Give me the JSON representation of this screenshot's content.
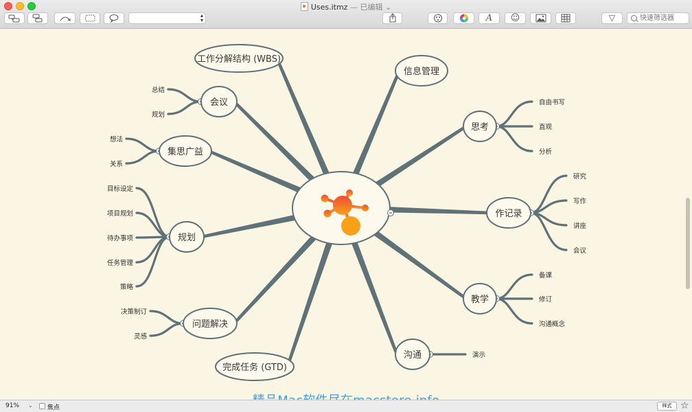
{
  "window": {
    "title": "Uses.itmz",
    "edited_label": "— 已编辑",
    "edited_chevron": "⌄"
  },
  "toolbar": {
    "search_placeholder": "快速筛选器",
    "icons": [
      "topic-icon",
      "subtopic-icon",
      "relationship-icon",
      "boundary-icon",
      "callout-icon",
      "share-icon",
      "theme-icon",
      "color-wheel-icon",
      "text-style-icon",
      "emoji-icon",
      "image-icon",
      "table-icon",
      "filter-icon"
    ],
    "text_style_glyph": "A",
    "emoji_glyph": "☺",
    "filter_glyph": "▽"
  },
  "colors": {
    "branch": "#5e7278",
    "canvas": "#fbf5e3",
    "node_fill": "#fdf9ec",
    "logo_top": "#ee4b35",
    "logo_bottom": "#f7a11a",
    "watermark": "#3aa1e6"
  },
  "map": {
    "left": [
      {
        "label": "工作分解结构 (WBS)",
        "children": []
      },
      {
        "label": "会议",
        "children": [
          "总结",
          "规划"
        ]
      },
      {
        "label": "集思广益",
        "children": [
          "想法",
          "关系"
        ]
      },
      {
        "label": "规划",
        "children": [
          "目标设定",
          "项目规划",
          "待办事项",
          "任务管理",
          "策略"
        ]
      },
      {
        "label": "问题解决",
        "children": [
          "决策制订",
          "灵感"
        ]
      },
      {
        "label": "完成任务 (GTD)",
        "children": []
      }
    ],
    "right": [
      {
        "label": "信息管理",
        "children": []
      },
      {
        "label": "思考",
        "children": [
          "自由书写",
          "直观",
          "分析"
        ]
      },
      {
        "label": "作记录",
        "children": [
          "研究",
          "写作",
          "讲座",
          "会议"
        ]
      },
      {
        "label": "教学",
        "children": [
          "备课",
          "修订",
          "沟通概念"
        ]
      },
      {
        "label": "沟通",
        "children": [
          "演示"
        ]
      }
    ],
    "collapse_glyph": "−"
  },
  "status": {
    "zoom": "91%",
    "zoom_arrow": "⌄",
    "focus_label": "焦点",
    "style_button": "样式",
    "star_glyph": "☆"
  },
  "watermark": "精品Mac软件尽在macstore.info"
}
